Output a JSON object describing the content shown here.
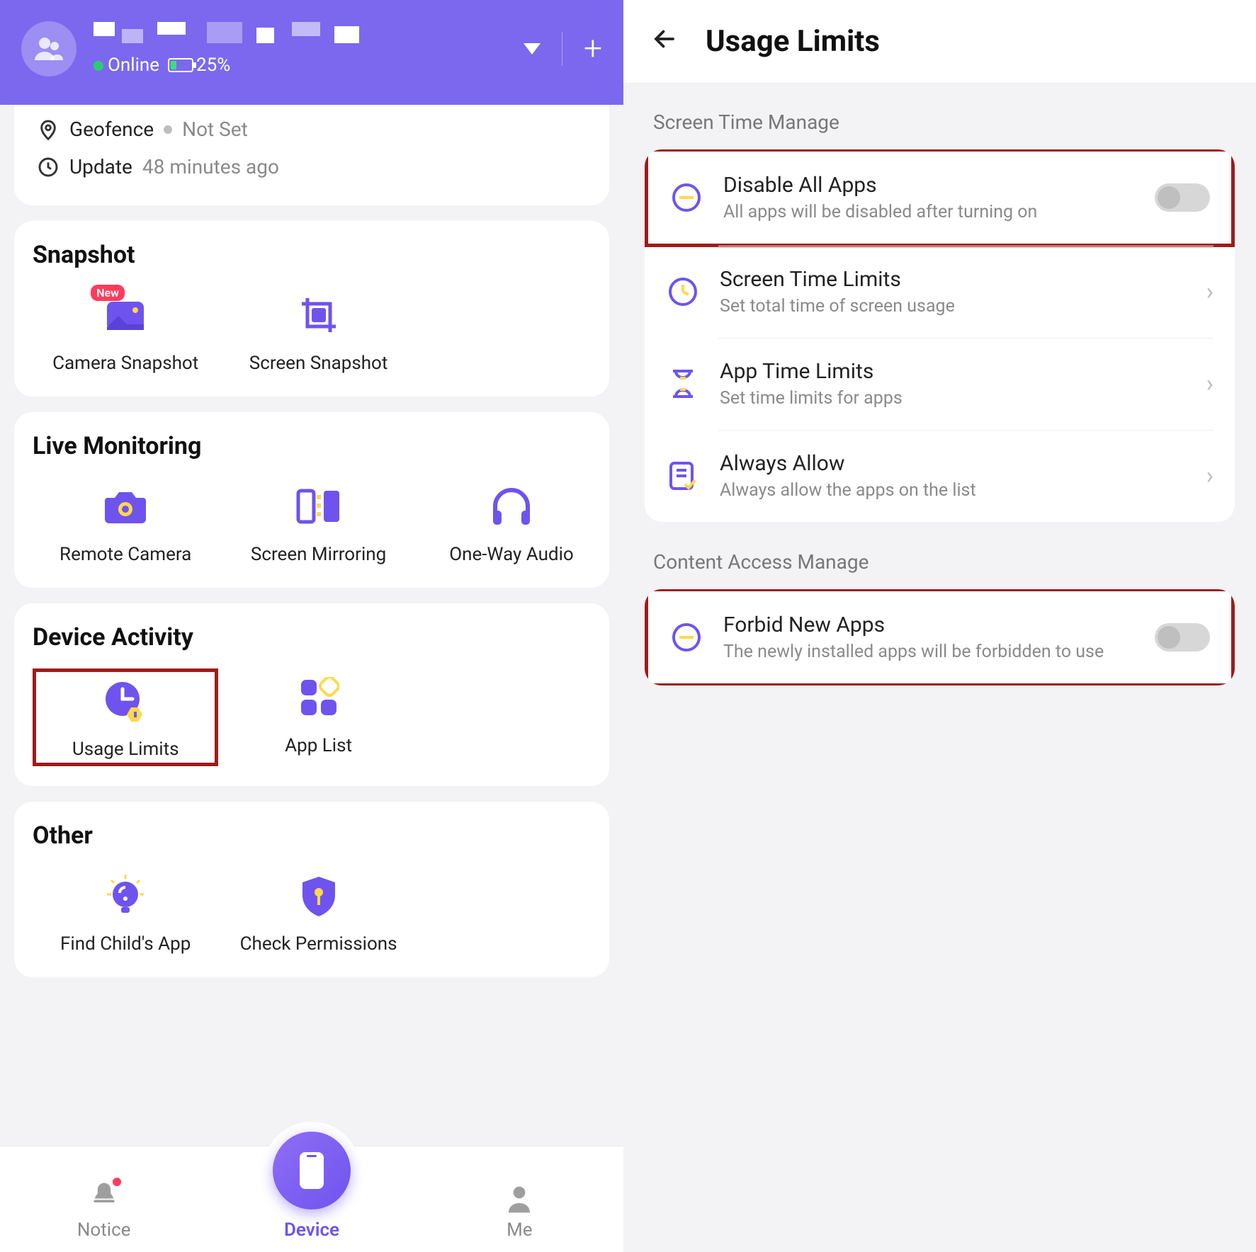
{
  "left": {
    "header": {
      "status_online": "Online",
      "battery_text": "25%"
    },
    "status_card": {
      "geofence_label": "Geofence",
      "geofence_value": "Not Set",
      "update_label": "Update",
      "update_value": "48 minutes ago"
    },
    "sections": {
      "snapshot": {
        "title": "Snapshot",
        "tiles": {
          "camera": "Camera Snapshot",
          "screen": "Screen Snapshot",
          "new_badge": "New"
        }
      },
      "live": {
        "title": "Live Monitoring",
        "tiles": {
          "camera": "Remote Camera",
          "mirror": "Screen Mirroring",
          "audio": "One-Way Audio"
        }
      },
      "activity": {
        "title": "Device Activity",
        "tiles": {
          "usage": "Usage Limits",
          "applist": "App List"
        }
      },
      "other": {
        "title": "Other",
        "tiles": {
          "find": "Find Child's App",
          "perm": "Check Permissions"
        }
      }
    },
    "nav": {
      "notice": "Notice",
      "device": "Device",
      "me": "Me"
    }
  },
  "right": {
    "title": "Usage Limits",
    "section1": "Screen Time Manage",
    "rows1": {
      "disable": {
        "title": "Disable All Apps",
        "sub": "All apps will be disabled after turning on"
      },
      "screen": {
        "title": "Screen Time Limits",
        "sub": "Set total time of screen usage"
      },
      "apptime": {
        "title": "App Time Limits",
        "sub": "Set time limits for apps"
      },
      "allow": {
        "title": "Always Allow",
        "sub": "Always allow the apps on the list"
      }
    },
    "section2": "Content Access Manage",
    "rows2": {
      "forbid": {
        "title": "Forbid New Apps",
        "sub": "The newly installed apps will be forbidden to use"
      }
    }
  }
}
